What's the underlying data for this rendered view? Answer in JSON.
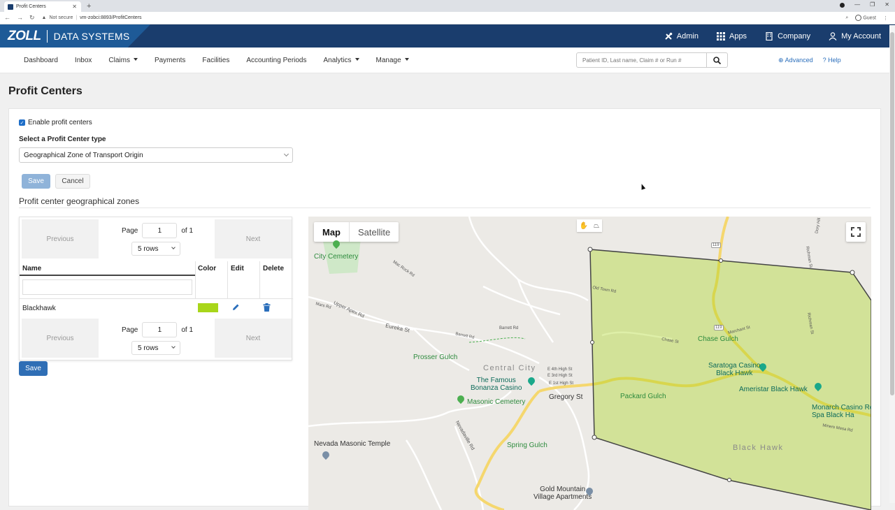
{
  "browser": {
    "tab_title": "Profit Centers",
    "new_tab": "+",
    "security": "Not secure",
    "url": "vm-zobci:8893/ProfitCenters",
    "profile": "Guest"
  },
  "header": {
    "logo": "ZOLL",
    "product": "DATA SYSTEMS",
    "nav": [
      {
        "label": "Admin",
        "icon": "tools-icon"
      },
      {
        "label": "Apps",
        "icon": "grid-icon"
      },
      {
        "label": "Company",
        "icon": "building-icon"
      },
      {
        "label": "My Account",
        "icon": "user-icon"
      }
    ],
    "colors": {
      "primary": "#1a3d6d",
      "brand": "#1e5a97"
    }
  },
  "subnav": {
    "items": [
      {
        "label": "Dashboard",
        "dropdown": false
      },
      {
        "label": "Inbox",
        "dropdown": false
      },
      {
        "label": "Claims",
        "dropdown": true
      },
      {
        "label": "Payments",
        "dropdown": false
      },
      {
        "label": "Facilities",
        "dropdown": false
      },
      {
        "label": "Accounting Periods",
        "dropdown": false
      },
      {
        "label": "Analytics",
        "dropdown": true
      },
      {
        "label": "Manage",
        "dropdown": true
      }
    ],
    "search_placeholder": "Patient ID, Last name, Claim # or Run #",
    "advanced": "Advanced",
    "help": "Help"
  },
  "page": {
    "title": "Profit Centers",
    "enable_label": "Enable profit centers",
    "enable_checked": true,
    "type_label": "Select a Profit Center type",
    "type_value": "Geographical Zone of Transport Origin",
    "save": "Save",
    "cancel": "Cancel",
    "section_title": "Profit center geographical zones"
  },
  "grid": {
    "previous": "Previous",
    "next": "Next",
    "page_label": "Page",
    "page_value": "1",
    "of_label": "of 1",
    "rows_value": "5 rows",
    "columns": [
      "Name",
      "Color",
      "Edit",
      "Delete"
    ],
    "rows": [
      {
        "name": "Blackhawk",
        "color": "#a8d61a"
      }
    ],
    "save": "Save"
  },
  "map": {
    "types": [
      "Map",
      "Satellite"
    ],
    "active_type": "Map",
    "places": {
      "city_cemetery": "City Cemetery",
      "prosser_gulch": "Prosser Gulch",
      "central_city": "Central City",
      "famous_bonanza": "The Famous\nBonanza Casino",
      "masonic_cemetery": "Masonic Cemetery",
      "gregory_st": "Gregory St",
      "packard_gulch": "Packard Gulch",
      "chase_gulch": "Chase Gulch",
      "saratoga": "Saratoga Casino\nBlack Hawk",
      "ameristar": "Ameristar Black Hawk",
      "monarch": "Monarch Casino Res\nSpa Black Ha",
      "black_hawk": "Black Hawk",
      "nevada_masonic": "Nevada Masonic Temple",
      "spring_gulch": "Spring Gulch",
      "gold_mountain": "Gold Mountain\nVillage Apartments",
      "eureka_st": "Eureka St",
      "upper_apex": "Upper Apex Rd",
      "route_119": "119",
      "nevadaville_rd": "Nevadaville Rd",
      "richman_st": "Richman St",
      "marchant_st": "Marchant St",
      "dory_hill": "Dory Hill",
      "chase_st": "Chase St",
      "barrett_rd": "Barrett Rd",
      "e_4th": "E 4th High St",
      "e_3rd": "E 3rd High St",
      "e_1st": "E 1st High St",
      "mars_rd": "Mars Rd",
      "mac_rock": "Mac Rock Rd",
      "old_town": "Old Town Rd",
      "miners_mesa": "Miners Mesa Rd"
    },
    "zone_color": "#a8d61a"
  }
}
